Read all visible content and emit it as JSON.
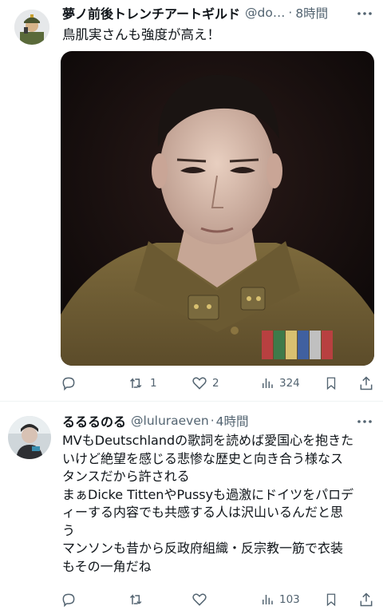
{
  "tweets": [
    {
      "author": "夢ノ前後トレンチアートギルド",
      "handle": "@do…",
      "time": "8時間",
      "text_lines": [
        "鳥肌実さんも強度が高え！"
      ],
      "media_icon": "photo-portrait-uniform",
      "stats": {
        "replies": "",
        "retweets": "1",
        "likes": "2",
        "views": "324"
      }
    },
    {
      "author": "るるるのる",
      "handle": "@luluraeven",
      "time": "4時間",
      "text_lines": [
        "MVもDeutschlandの歌詞を読めば愛国心を抱きた",
        "いけど絶望を感じる悲惨な歴史と向き合う様なス",
        "タンスだから許される",
        "まぁDicke TittenやPussyも過激にドイツをパロデ",
        "ィーする内容でも共感する人は沢山いるんだと思",
        "う",
        "マンソンも昔から反政府組織・反宗教一筋で衣装",
        "もその一角だね"
      ],
      "stats": {
        "replies": "",
        "retweets": "",
        "likes": "",
        "views": "103"
      }
    }
  ],
  "separators": {
    "handle_time": "·"
  },
  "icons": {
    "more": "more-horizontal-icon",
    "reply": "reply-icon",
    "retweet": "retweet-icon",
    "like": "heart-icon",
    "views": "views-chart-icon",
    "bookmark": "bookmark-icon",
    "share": "share-icon"
  },
  "colors": {
    "text": "#0f1419",
    "secondary": "#536471",
    "divider": "#eff3f4"
  }
}
